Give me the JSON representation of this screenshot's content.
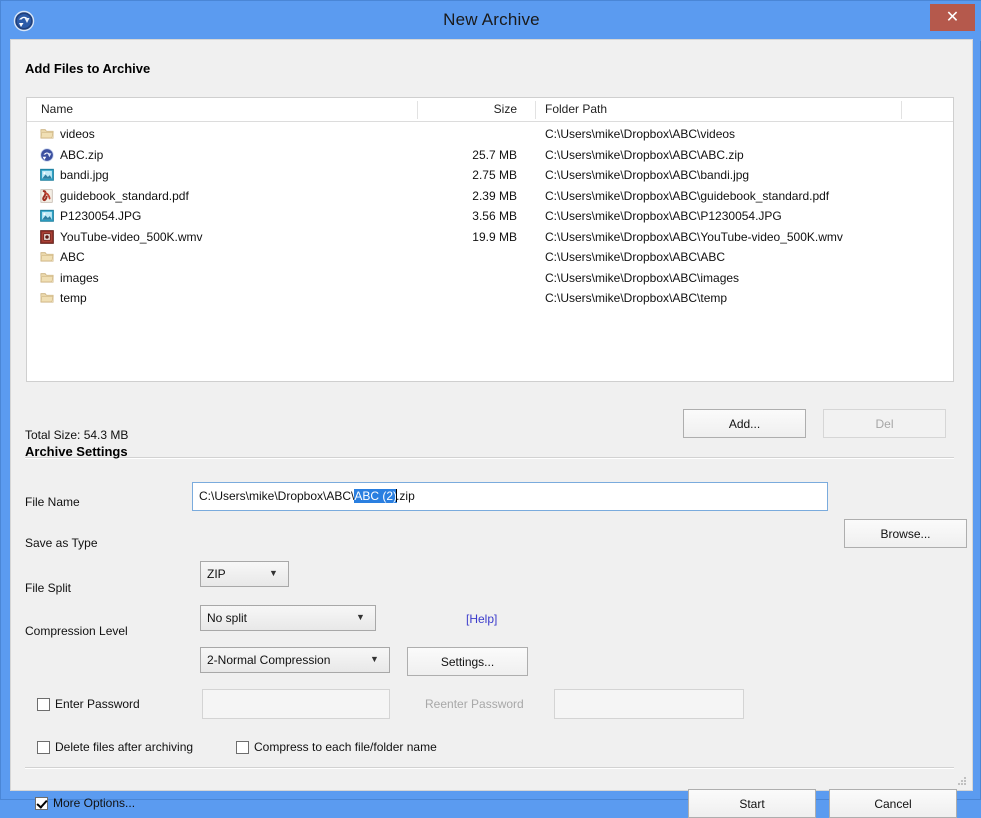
{
  "window": {
    "title": "New Archive",
    "app_icon": "archive-app-icon",
    "close_label": "✕",
    "frame_color": "#5b9bf0",
    "close_color": "#b5594c"
  },
  "sections": {
    "add_files_title": "Add Files to Archive",
    "archive_settings_title": "Archive Settings"
  },
  "filelist": {
    "columns": [
      "Name",
      "Size",
      "Folder Path",
      ""
    ],
    "rows": [
      {
        "icon": "folder-icon",
        "name": "videos",
        "size": "",
        "path": "C:\\Users\\mike\\Dropbox\\ABC\\videos"
      },
      {
        "icon": "zip-icon",
        "name": "ABC.zip",
        "size": "25.7 MB",
        "path": "C:\\Users\\mike\\Dropbox\\ABC\\ABC.zip"
      },
      {
        "icon": "image-icon",
        "name": "bandi.jpg",
        "size": "2.75 MB",
        "path": "C:\\Users\\mike\\Dropbox\\ABC\\bandi.jpg"
      },
      {
        "icon": "pdf-icon",
        "name": "guidebook_standard.pdf",
        "size": "2.39 MB",
        "path": "C:\\Users\\mike\\Dropbox\\ABC\\guidebook_standard.pdf"
      },
      {
        "icon": "image-icon",
        "name": "P1230054.JPG",
        "size": "3.56 MB",
        "path": "C:\\Users\\mike\\Dropbox\\ABC\\P1230054.JPG"
      },
      {
        "icon": "video-icon",
        "name": "YouTube-video_500K.wmv",
        "size": "19.9 MB",
        "path": "C:\\Users\\mike\\Dropbox\\ABC\\YouTube-video_500K.wmv"
      },
      {
        "icon": "folder-icon",
        "name": "ABC",
        "size": "",
        "path": "C:\\Users\\mike\\Dropbox\\ABC\\ABC"
      },
      {
        "icon": "folder-icon",
        "name": "images",
        "size": "",
        "path": "C:\\Users\\mike\\Dropbox\\ABC\\images"
      },
      {
        "icon": "folder-icon",
        "name": "temp",
        "size": "",
        "path": "C:\\Users\\mike\\Dropbox\\ABC\\temp"
      }
    ]
  },
  "toolbar": {
    "total_size": "Total Size: 54.3 MB",
    "add_label": "Add...",
    "del_label": "Del",
    "del_enabled": false
  },
  "settings": {
    "filename_label": "File Name",
    "filename_prefix": "C:\\Users\\mike\\Dropbox\\ABC\\",
    "filename_selected": "ABC (2)",
    "filename_suffix": ".zip",
    "browse_label": "Browse...",
    "savetype_label": "Save as Type",
    "savetype_value": "ZIP",
    "savetype_options": [
      "ZIP"
    ],
    "filesplit_label": "File Split",
    "filesplit_value": "No split",
    "filesplit_options": [
      "No split"
    ],
    "help_label": "[Help]",
    "help_color": "#3b3bcc",
    "complevel_label": "Compression Level",
    "complevel_value": "2-Normal Compression",
    "complevel_options": [
      "2-Normal Compression"
    ],
    "settings_label": "Settings...",
    "enter_password_label": "Enter Password",
    "enter_password_checked": false,
    "password_value": "",
    "reenter_password_label": "Reenter Password",
    "reenter_password_value": "",
    "delete_files_label": "Delete files after archiving",
    "delete_files_checked": false,
    "compress_each_label": "Compress to each file/folder name",
    "compress_each_checked": false
  },
  "footer": {
    "more_options_label": "More Options...",
    "more_options_checked": true,
    "start_label": "Start",
    "cancel_label": "Cancel"
  }
}
